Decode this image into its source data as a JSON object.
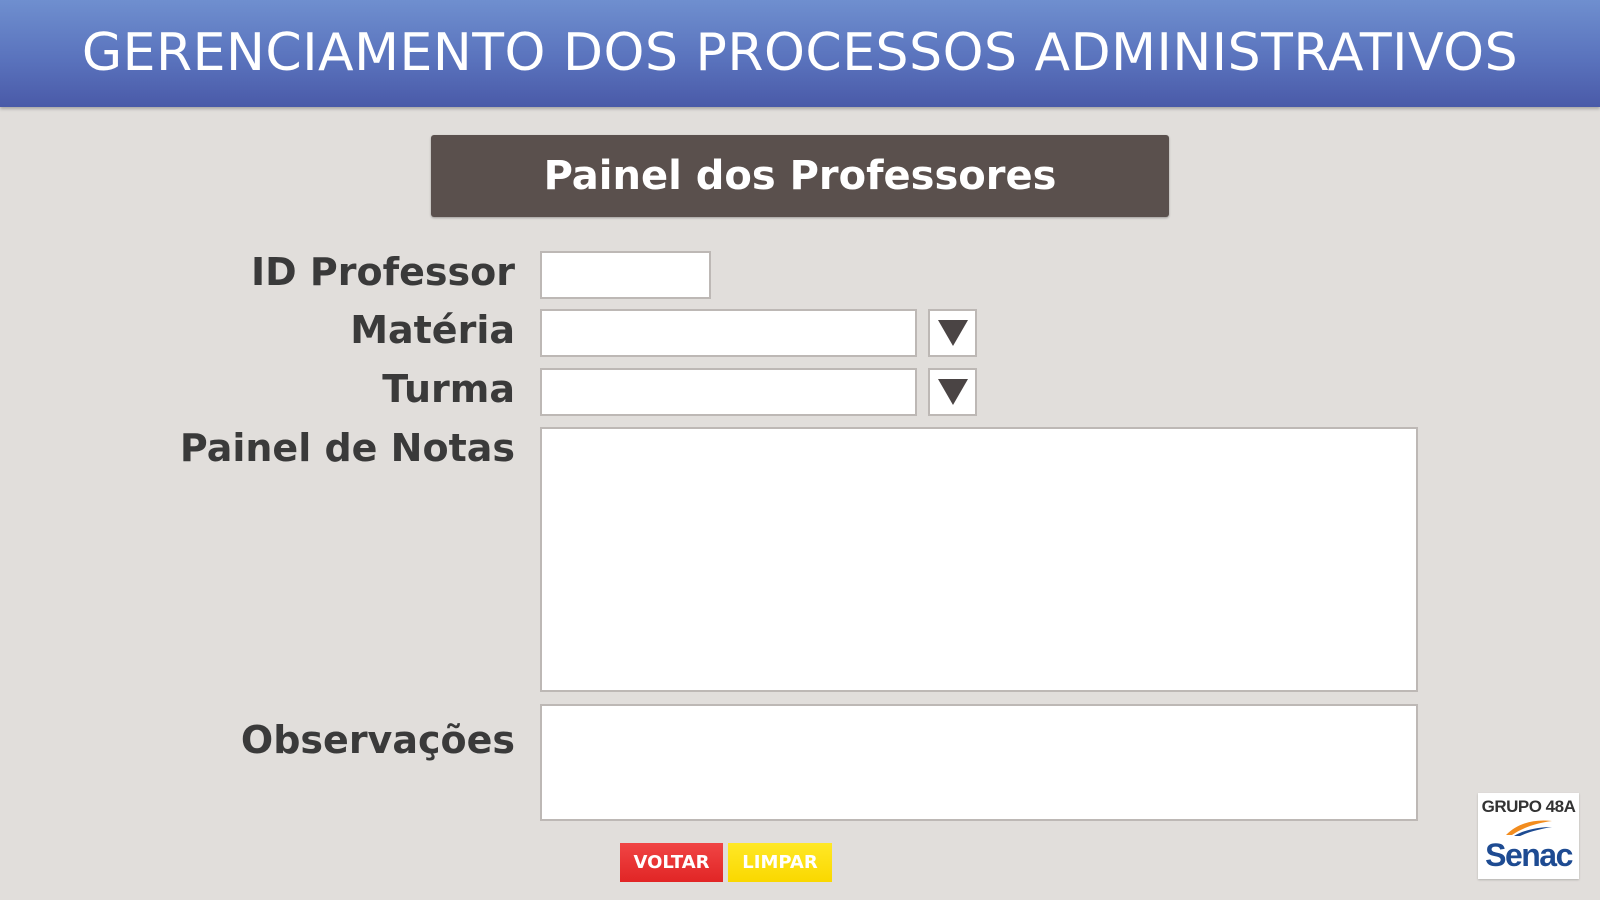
{
  "header": {
    "title": "GERENCIAMENTO DOS PROCESSOS ADMINISTRATIVOS"
  },
  "panel": {
    "title": "Painel dos Professores"
  },
  "form": {
    "id_professor": {
      "label": "ID Professor",
      "value": ""
    },
    "materia": {
      "label": "Matéria",
      "value": ""
    },
    "turma": {
      "label": "Turma",
      "value": ""
    },
    "painel_notas": {
      "label": "Painel de Notas",
      "value": ""
    },
    "observacoes": {
      "label": "Observações",
      "value": ""
    }
  },
  "buttons": {
    "voltar": "VOLTAR",
    "limpar": "LIMPAR"
  },
  "logo": {
    "group": "GRUPO 48A",
    "brand": "Senac"
  },
  "colors": {
    "header": "#5a73bd",
    "banner": "#5a504d",
    "background": "#e1dedb",
    "voltar": "#e12525",
    "limpar": "#fad800",
    "brand": "#1e4b92",
    "swoosh": "#f28c1e"
  }
}
